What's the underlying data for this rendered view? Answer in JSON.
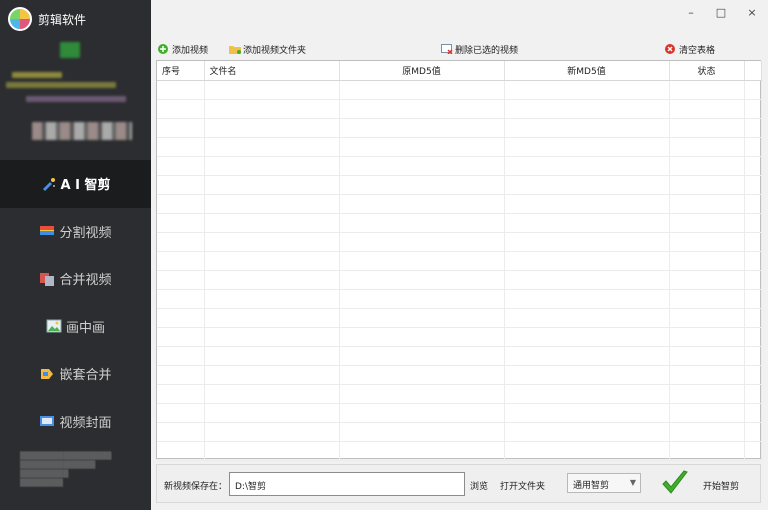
{
  "app": {
    "name": "剪辑软件"
  },
  "window_controls": {
    "minimize": "–",
    "maximize": "□",
    "close": "×"
  },
  "sidebar": {
    "items": [
      {
        "label": "A I 智剪",
        "icon": "ai-cut-icon",
        "active": true
      },
      {
        "label": "分割视频",
        "icon": "split-video-icon",
        "active": false
      },
      {
        "label": "合并视频",
        "icon": "merge-video-icon",
        "active": false
      },
      {
        "label": "画中画",
        "icon": "picture-in-picture-icon",
        "active": false
      },
      {
        "label": "嵌套合并",
        "icon": "nested-merge-icon",
        "active": false
      },
      {
        "label": "视频封面",
        "icon": "video-cover-icon",
        "active": false
      }
    ]
  },
  "toolbar": {
    "add_video": "添加视频",
    "add_folder": "添加视频文件夹",
    "delete_selected": "删除已选的视频",
    "clear_table": "清空表格"
  },
  "table": {
    "columns": [
      "序号",
      "文件名",
      "原MD5值",
      "新MD5值",
      "状态"
    ],
    "rows": []
  },
  "bottom": {
    "save_label": "新视频保存在：",
    "save_path": "D:\\智剪",
    "browse": "浏览",
    "open_folder": "打开文件夹",
    "mode": "通用智剪",
    "start": "开始智剪"
  },
  "colors": {
    "sidebar_bg": "#2c2d30",
    "active_bg": "#1b1c1e",
    "check_green": "#3fae2a"
  }
}
